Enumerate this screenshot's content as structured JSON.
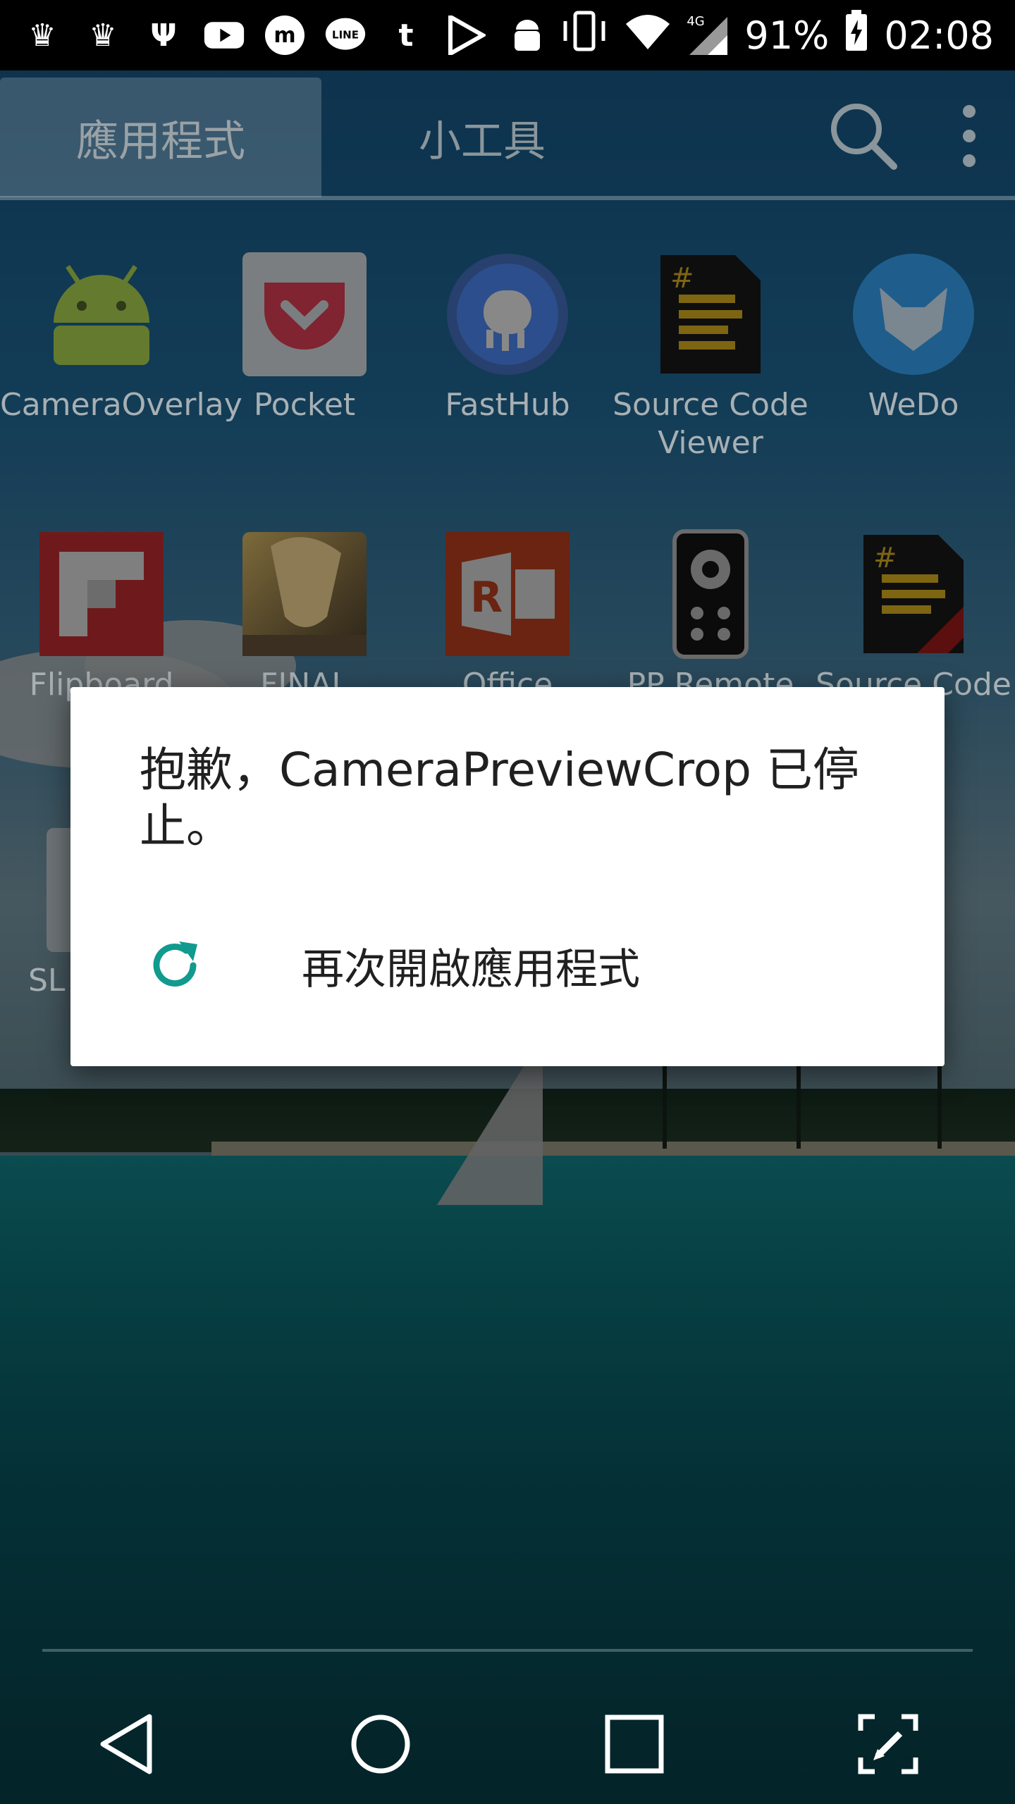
{
  "status_bar": {
    "icons": [
      "crown-icon",
      "crown-icon",
      "usb-icon",
      "youtube-icon",
      "m-app-icon",
      "line-icon",
      "tumblr-icon",
      "play-store-icon",
      "android-debug-icon"
    ],
    "network_label": "4G",
    "battery": "91%",
    "time": "02:08"
  },
  "drawer": {
    "tabs": [
      {
        "label": "應用程式",
        "active": true
      },
      {
        "label": "小工具",
        "active": false
      }
    ]
  },
  "apps": [
    {
      "label": "CameraOverlay",
      "icon": "android-icon"
    },
    {
      "label": "Pocket",
      "icon": "pocket-icon"
    },
    {
      "label": "FastHub",
      "icon": "fasthub-icon"
    },
    {
      "label": "Source Code Viewer",
      "icon": "source-code-icon"
    },
    {
      "label": "WeDo",
      "icon": "fox-icon"
    },
    {
      "label": "Flipboard",
      "icon": "flipboard-icon"
    },
    {
      "label": "FINAL",
      "icon": "final-fantasy-icon"
    },
    {
      "label": "Office",
      "icon": "office-remote-icon"
    },
    {
      "label": "PP Remote",
      "icon": "remote-icon"
    },
    {
      "label": "Source Code Pro",
      "icon": "source-code-pro-icon"
    },
    {
      "label": "SL",
      "icon": "app-icon"
    }
  ],
  "dialog": {
    "message": "抱歉，CameraPreviewCrop 已停止。",
    "action_label": "再次開啟應用程式",
    "accent": "#119a8e"
  },
  "navbar": [
    "back-icon",
    "home-icon",
    "recents-icon",
    "edit-screen-icon"
  ]
}
